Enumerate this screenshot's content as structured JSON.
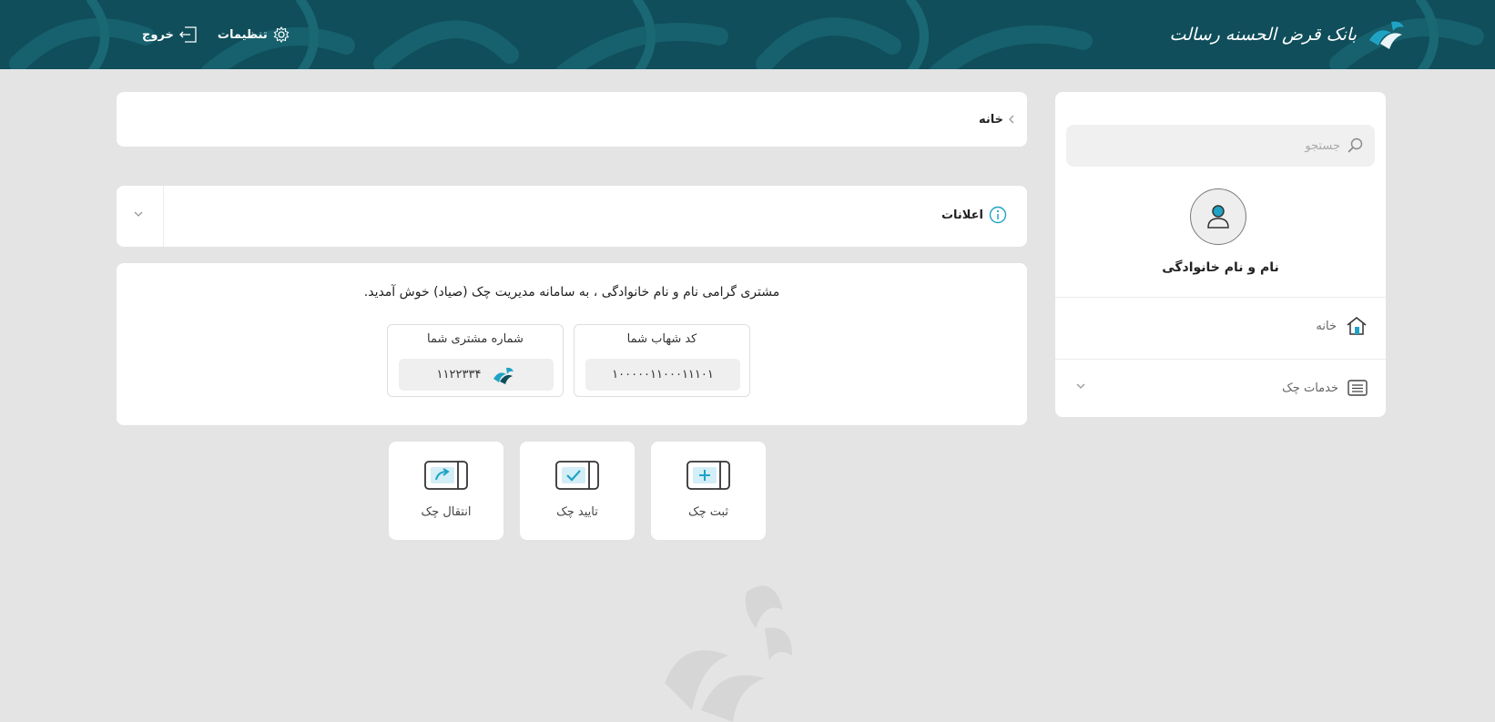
{
  "header": {
    "brand_name": "بانک قرض الحسنه رسالت",
    "settings_label": "تنظیمات",
    "logout_label": "خروج"
  },
  "sidebar": {
    "search_placeholder": "جستجو",
    "user_name": "نام و نام خانوادگی",
    "nav": [
      {
        "label": "خانه",
        "icon": "home-icon"
      },
      {
        "label": "خدمات چک",
        "icon": "list-icon"
      }
    ]
  },
  "breadcrumb": {
    "current": "خانه"
  },
  "announcements": {
    "title": "اعلانات"
  },
  "welcome": {
    "message": "مشتری گرامی نام و نام خانوادگی ، به سامانه مدیریت چک (صیاد) خوش آمدید.",
    "shahab_label": "کد شهاب شما",
    "shahab_value": "۱۰۰۰۰۰۱۱۰۰۰۱۱۱۰۱",
    "customer_label": "شماره مشتری شما",
    "customer_value": "۱۱۲۲۳۳۴"
  },
  "actions": [
    {
      "label": "ثبت چک",
      "icon": "cheque-add-icon"
    },
    {
      "label": "تایید چک",
      "icon": "cheque-confirm-icon"
    },
    {
      "label": "انتقال چک",
      "icon": "cheque-transfer-icon"
    }
  ],
  "colors": {
    "header_bg": "#0f4e5a",
    "accent": "#1fa3c5",
    "page_bg": "#e4e4e4"
  }
}
